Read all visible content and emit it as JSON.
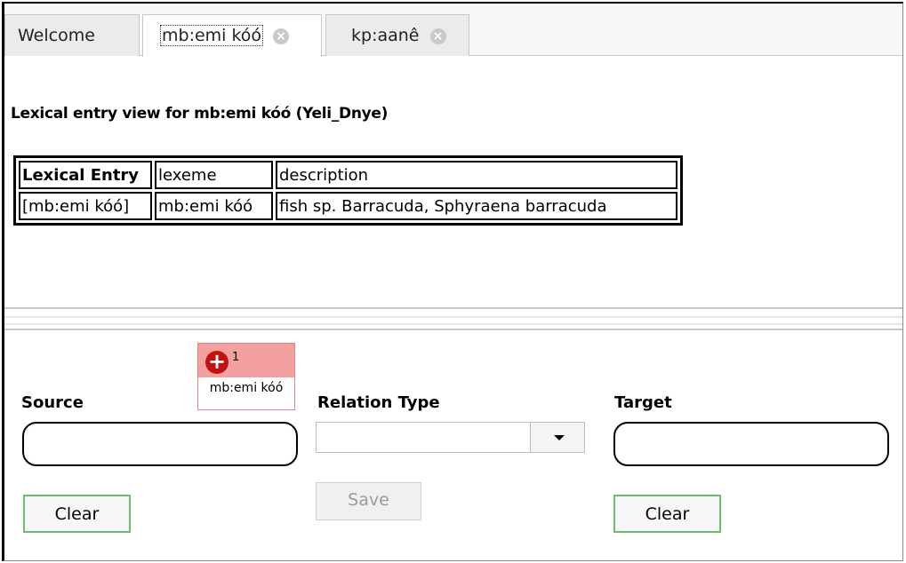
{
  "tabs": [
    {
      "label": "Welcome",
      "closable": false,
      "active": false
    },
    {
      "label": "mb:emi kóó",
      "closable": true,
      "active": true
    },
    {
      "label": "kp:aanê",
      "closable": true,
      "active": false
    }
  ],
  "entry_view": {
    "title": "Lexical entry view for mb:emi kóó (Yeli_Dnye)",
    "table": {
      "headers": [
        "Lexical Entry",
        "lexeme",
        "description"
      ],
      "row": [
        "[mb:emi kóó]",
        "mb:emi kóó",
        "fish sp. Barracuda, Sphyraena barracuda"
      ]
    }
  },
  "drag_item": {
    "icon": "plus-circle-icon",
    "count": "1",
    "label": "mb:emi kóó",
    "color": "#f4a0a0"
  },
  "relation_editor": {
    "source_label": "Source",
    "source_value": "",
    "relation_type_label": "Relation Type",
    "relation_type_value": "",
    "target_label": "Target",
    "target_value": "",
    "source_clear": "Clear",
    "save": "Save",
    "target_clear": "Clear"
  },
  "colors": {
    "button_border": "#6bbf6b",
    "close_icon": "#c9c9c9",
    "plus_icon": "#c11212"
  }
}
